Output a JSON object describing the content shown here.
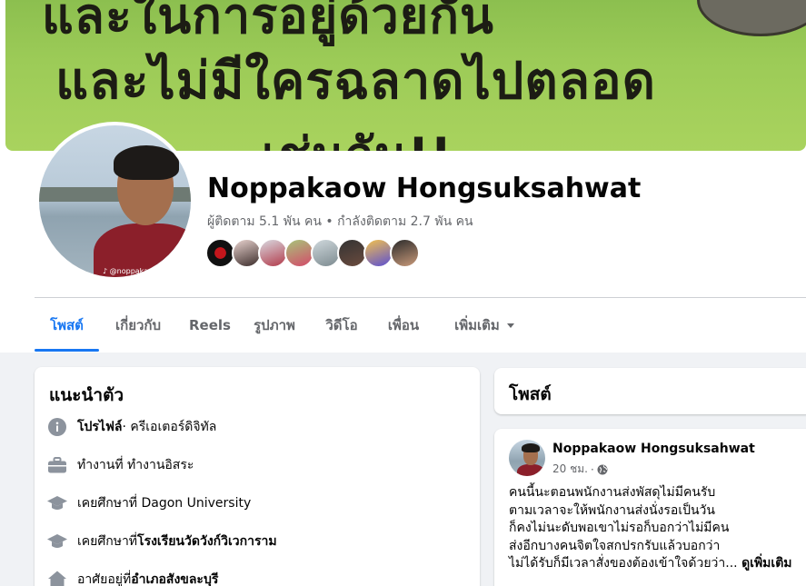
{
  "cover": {
    "line1": "และในการอยู่ด้วยกัน",
    "line2": "และไม่มีใครฉลาดไปตลอด",
    "line3": "เช่นกัน!!"
  },
  "profile": {
    "name": "Noppakaow Hongsuksahwat",
    "stats": "ผู้ติดตาม 5.1 พัน คน • กำลังติดตาม 2.7 พัน คน",
    "avatar_tag": "♪ @noppakao"
  },
  "tabs": [
    {
      "label": "โพสต์",
      "active": true
    },
    {
      "label": "เกี่ยวกับ"
    },
    {
      "label": "Reels"
    },
    {
      "label": "รูปภาพ"
    },
    {
      "label": "วิดีโอ"
    },
    {
      "label": "เพื่อน"
    },
    {
      "label": "เพิ่มเติม"
    }
  ],
  "intro": {
    "title": "แนะนำตัว",
    "rows": [
      {
        "icon": "info-icon",
        "prefix": "",
        "bold": "โปรไฟล์",
        "suffix": " · ครีเอเตอร์ดิจิทัล"
      },
      {
        "icon": "briefcase-icon",
        "prefix": "ทำงานที่ ทำงานอิสระ",
        "bold": "",
        "suffix": ""
      },
      {
        "icon": "graduation-cap-icon",
        "prefix": "เคยศึกษาที่ Dagon University",
        "bold": "",
        "suffix": ""
      },
      {
        "icon": "graduation-cap-icon",
        "prefix": "เคยศึกษาที่ ",
        "bold": "โรงเรียนวัดวังก์วิเวการาม",
        "suffix": ""
      },
      {
        "icon": "home-icon",
        "prefix": "อาศัยอยู่ที่ ",
        "bold": "อำเภอสังขละบุรี",
        "suffix": ""
      }
    ]
  },
  "posts": {
    "title": "โพสต์",
    "author": "Noppakaow Hongsuksahwat",
    "time": "20 ชม.",
    "visibility_icon": "globe-icon",
    "lines": [
      "คนนี้นะตอนพนักงานส่งพัสดุไม่มีคนรับ",
      "ตามเวลาจะให้พนักงานส่งนั่งรอเป็นวัน",
      "ก็คงไม่นะดับพอเขาไม่รอก็บอกว่าไม่มีคน",
      "ส่งอีกบางคนจิตใจสกปรกรับแล้วบอกว่า"
    ],
    "last_line": "ไม่ได้รับก็มีเวลาสั่งของต้องเข้าใจด้วยว่า...",
    "see_more": "ดูเพิ่มเติม"
  },
  "colors": {
    "accent": "#1877f2",
    "secondary_text": "#65676b",
    "background": "#f0f2f5"
  }
}
